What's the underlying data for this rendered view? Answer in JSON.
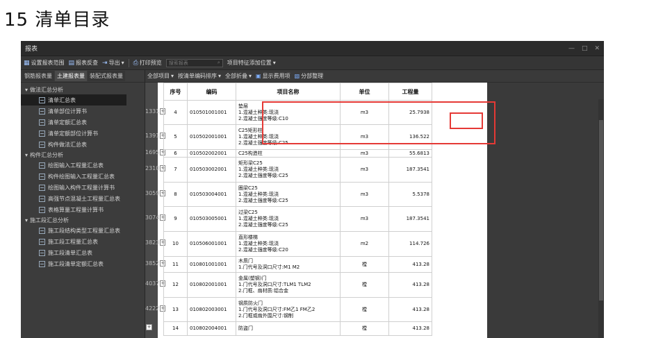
{
  "heading": "15 清单目录",
  "window": {
    "title": "报表",
    "minimize": "—",
    "maximize": "□",
    "close": "✕"
  },
  "toolbar": {
    "items": [
      "设置报表范围",
      "报表反查",
      "导出",
      "打印预览"
    ],
    "search_placeholder": "搜索报表",
    "project_features": "项目特征添加位置"
  },
  "sidebar": {
    "tabs": [
      "钢筋报表量",
      "土建报表量",
      "装配式报表量"
    ],
    "groups": [
      {
        "label": "做法汇总分析",
        "items": [
          "清单汇总表",
          "清单部位计算书",
          "清单定额汇总表",
          "清单定额部位计算书",
          "构件做法汇总表"
        ]
      },
      {
        "label": "构件汇总分析",
        "items": [
          "绘图输入工程量汇总表",
          "构件绘图输入工程量汇总表",
          "绘图输入构件工程量计算书",
          "高强节点混凝土工程量汇总表",
          "表格算量工程量计算书"
        ]
      },
      {
        "label": "施工段汇总分析",
        "items": [
          "施工段结构类型工程量汇总表",
          "施工段工程量汇总表",
          "施工段清单汇总表",
          "施工段清单定额汇总表"
        ]
      }
    ]
  },
  "subtoolbar": {
    "items": [
      "全部项目",
      "按清单编码排序",
      "全部折叠",
      "显示费用项",
      "分部整理"
    ]
  },
  "grid": {
    "headers": [
      "序号",
      "编码",
      "项目名称",
      "单位",
      "工程量"
    ],
    "rows": [
      {
        "rn": "1331",
        "seq": "4",
        "code": "010501001001",
        "name": [
          "垫层",
          "1.混凝土种类:现浇",
          "2.混凝土强度等级:C10"
        ],
        "unit": "m3",
        "qty": "25.7938"
      },
      {
        "rn": "1391",
        "seq": "5",
        "code": "010502001001",
        "name": [
          "C25矩形柱",
          "1.混凝土种类:现浇",
          "2.混凝土强度等级:C25"
        ],
        "unit": "m3",
        "qty": "136.522"
      },
      {
        "rn": "1695",
        "seq": "6",
        "code": "010502002001",
        "name": [
          "C25构造柱"
        ],
        "unit": "m3",
        "qty": "55.6813"
      },
      {
        "rn": "2310",
        "seq": "7",
        "code": "010503002001",
        "name": [
          "矩形梁C25",
          "1.混凝土种类:现浇",
          "2.混凝土强度等级:C25"
        ],
        "unit": "m3",
        "qty": "187.3541"
      },
      {
        "rn": "3059",
        "seq": "8",
        "code": "010503004001",
        "name": [
          "圈梁C25",
          "1.混凝土种类:现浇",
          "2.混凝土强度等级:C25"
        ],
        "unit": "m3",
        "qty": "5.5378"
      },
      {
        "rn": "3074",
        "seq": "9",
        "code": "010503005001",
        "name": [
          "过梁C25",
          "1.混凝土种类:现浇",
          "2.混凝土强度等级:C25"
        ],
        "unit": "m3",
        "qty": "187.3541"
      },
      {
        "rn": "3823",
        "seq": "10",
        "code": "010506001001",
        "name": [
          "直形楼梯",
          "1.混凝土种类:现浇",
          "2.混凝土强度等级:C20"
        ],
        "unit": "m2",
        "qty": "114.726"
      },
      {
        "rn": "3852",
        "seq": "11",
        "code": "010801001001",
        "name": [
          "木质门",
          "1.门代号及洞口尺寸:M1 M2"
        ],
        "unit": "樘",
        "qty": "413.28"
      },
      {
        "rn": "4037",
        "seq": "12",
        "code": "010802001001",
        "name": [
          "金属(塑钢)门",
          "1.门代号及洞口尺寸:TLM1 TLM2",
          "2.门框、扇材质:铝合金"
        ],
        "unit": "樘",
        "qty": "413.28"
      },
      {
        "rn": "4222",
        "seq": "13",
        "code": "010802003001",
        "name": [
          "钢质防火门",
          "1.门代号及洞口尺寸:FM乙1 FM乙2",
          "2.门框或扇外围尺寸:钢制"
        ],
        "unit": "樘",
        "qty": "413.28"
      },
      {
        "rn": "",
        "seq": "14",
        "code": "010802004001",
        "name": [
          "防盗门"
        ],
        "unit": "樘",
        "qty": "413.28"
      }
    ]
  }
}
